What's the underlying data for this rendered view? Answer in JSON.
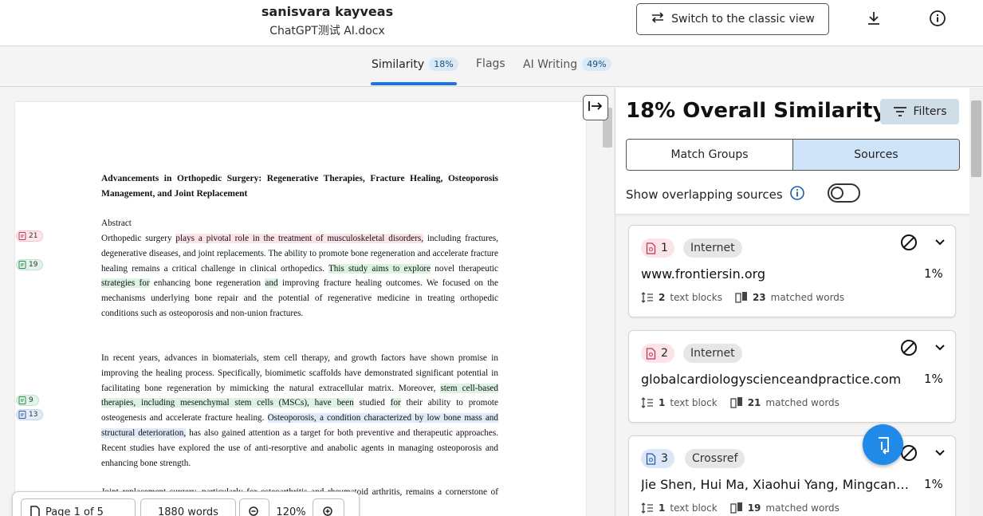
{
  "header": {
    "owner": "sanisvara kayveas",
    "file_name": "ChatGPT测试 AI.docx",
    "classic_view_label": "Switch to the classic view",
    "download_icon": "download-icon",
    "info_icon": "info-icon"
  },
  "tabs": [
    {
      "label": "Similarity",
      "badge": "18%"
    },
    {
      "label": "Flags",
      "badge": ""
    },
    {
      "label": "AI Writing",
      "badge": "49%"
    }
  ],
  "document": {
    "title": "Advancements in Orthopedic Surgery: Regenerative Therapies, Fracture Healing, Osteoporosis Management, and Joint Replacement",
    "abstract_heading": "Abstract",
    "p1": {
      "a": "Orthopedic surgery ",
      "b": "plays a pivotal role in the treatment of musculoskeletal disorders,",
      "c": " including fractures, degenerative diseases, and joint replacements. The ability to promote bone regeneration and accelerate fracture healing remains a critical challenge in clinical orthopedics. ",
      "d": "This study aims to explore",
      "e": " novel therapeutic ",
      "f": "strategies for",
      "g": " enhancing bone regeneration ",
      "h": "and",
      "i": " improving fracture healing outcomes. We focused on the mechanisms underlying bone repair and the potential of regenerative medicine in treating orthopedic conditions such as osteoporosis and non-union fractures."
    },
    "p2": {
      "a": "In recent years, advances in biomaterials, stem cell therapy, and growth factors have shown promise in improving the healing process. Specifically, biomimetic scaffolds have demonstrated significant potential in facilitating bone regeneration by mimicking the natural extracellular matrix. Moreover, ",
      "b": "stem cell-based therapies, including mesenchymal stem cells (MSCs), have been",
      "c": " studied ",
      "d": "for",
      "e": " their ability to promote osteogenesis and accelerate fracture healing. ",
      "f": "Osteoporosis, a condition characterized by low bone mass and structural deterioration,",
      "g": " has also gained attention as a target for both preventive and therapeutic approaches. Recent studies have explored the use of anti-resorptive and anabolic agents in managing osteoporosis and enhancing bone strength."
    },
    "p3": "Joint replacement surgery, particularly for osteoarthritis and rheumatoid arthritis, remains a cornerstone of orthopedic treatment. Advances in prosthetics and improved",
    "marks": [
      {
        "num": "21",
        "color": "pink"
      },
      {
        "num": "19",
        "color": "green"
      },
      {
        "num": "9",
        "color": "green"
      },
      {
        "num": "13",
        "color": "blue"
      }
    ]
  },
  "bottom_bar": {
    "page": "Page 1 of 5",
    "words": "1880 words",
    "zoom": "120%"
  },
  "panel": {
    "title": "18% Overall Similarity",
    "filters_label": "Filters",
    "seg_match": "Match Groups",
    "seg_sources": "Sources",
    "overlap_label": "Show overlapping sources",
    "sources": [
      {
        "rank": "1",
        "type": "Internet",
        "name": "www.frontiersin.org",
        "pct": "1%",
        "blocks_num": "2",
        "blocks_label": "text blocks",
        "words_num": "23",
        "words_label": "matched words",
        "color": "pink"
      },
      {
        "rank": "2",
        "type": "Internet",
        "name": "globalcardiologyscienceandpractice.com",
        "pct": "1%",
        "blocks_num": "1",
        "blocks_label": "text block",
        "words_num": "21",
        "words_label": "matched words",
        "color": "pink"
      },
      {
        "rank": "3",
        "type": "Crossref",
        "name": "Jie Shen, Hui Ma, Xiaohui Yang, Mingcan Huang",
        "pct": "1%",
        "blocks_num": "1",
        "blocks_label": "text block",
        "words_num": "19",
        "words_label": "matched words",
        "color": "blue"
      }
    ]
  }
}
